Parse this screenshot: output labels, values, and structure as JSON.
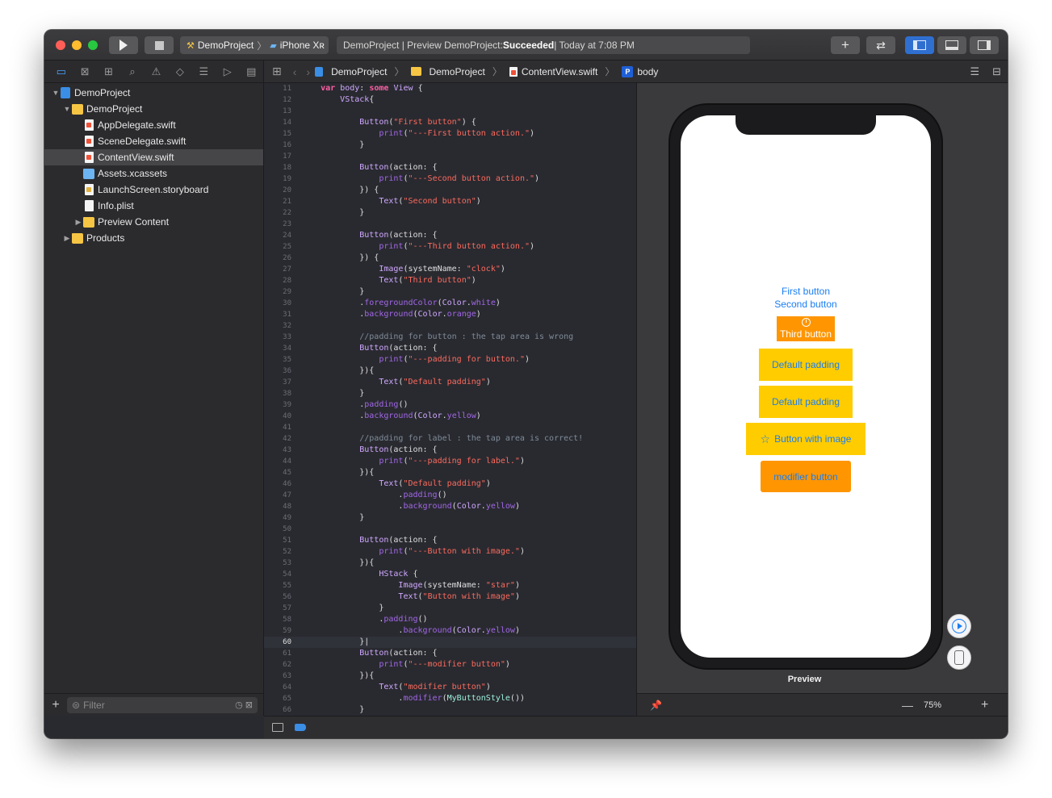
{
  "toolbar": {
    "scheme_project": "DemoProject",
    "scheme_device": "iPhone Xʀ",
    "status_prefix": "DemoProject | Preview DemoProject: ",
    "status_result": "Succeeded",
    "status_suffix": " | Today at 7:08 PM"
  },
  "navigator": {
    "items": [
      {
        "label": "DemoProject",
        "kind": "project",
        "indent": 0,
        "disclosure": "▼"
      },
      {
        "label": "DemoProject",
        "kind": "folder",
        "indent": 1,
        "disclosure": "▼"
      },
      {
        "label": "AppDelegate.swift",
        "kind": "swift",
        "indent": 2,
        "disclosure": ""
      },
      {
        "label": "SceneDelegate.swift",
        "kind": "swift",
        "indent": 2,
        "disclosure": ""
      },
      {
        "label": "ContentView.swift",
        "kind": "swift",
        "indent": 2,
        "disclosure": "",
        "selected": true
      },
      {
        "label": "Assets.xcassets",
        "kind": "assets",
        "indent": 2,
        "disclosure": ""
      },
      {
        "label": "LaunchScreen.storyboard",
        "kind": "storyboard",
        "indent": 2,
        "disclosure": ""
      },
      {
        "label": "Info.plist",
        "kind": "file",
        "indent": 2,
        "disclosure": ""
      },
      {
        "label": "Preview Content",
        "kind": "folder",
        "indent": 2,
        "disclosure": "▶"
      },
      {
        "label": "Products",
        "kind": "folder",
        "indent": 1,
        "disclosure": "▶"
      }
    ],
    "filter_placeholder": "Filter"
  },
  "jumpbar": {
    "crumbs": [
      "DemoProject",
      "DemoProject",
      "ContentView.swift",
      "body"
    ]
  },
  "editor": {
    "current_line": 60,
    "lines": [
      {
        "n": "11",
        "html": "    <span class='k'>var</span> <span class='t'>body</span>: <span class='k'>some</span> <span class='t'>View</span> {"
      },
      {
        "n": "12",
        "html": "        <span class='t'>VStack</span>{"
      },
      {
        "n": "13",
        "html": ""
      },
      {
        "n": "14",
        "html": "            <span class='t'>Button</span>(<span class='s'>\"First button\"</span>) {"
      },
      {
        "n": "15",
        "html": "                <span class='m'>print</span>(<span class='s'>\"---First button action.\"</span>)"
      },
      {
        "n": "16",
        "html": "            }"
      },
      {
        "n": "17",
        "html": ""
      },
      {
        "n": "18",
        "html": "            <span class='t'>Button</span>(action: {"
      },
      {
        "n": "19",
        "html": "                <span class='m'>print</span>(<span class='s'>\"---Second button action.\"</span>)"
      },
      {
        "n": "20",
        "html": "            }) {"
      },
      {
        "n": "21",
        "html": "                <span class='t'>Text</span>(<span class='s'>\"Second button\"</span>)"
      },
      {
        "n": "22",
        "html": "            }"
      },
      {
        "n": "23",
        "html": ""
      },
      {
        "n": "24",
        "html": "            <span class='t'>Button</span>(action: {"
      },
      {
        "n": "25",
        "html": "                <span class='m'>print</span>(<span class='s'>\"---Third button action.\"</span>)"
      },
      {
        "n": "26",
        "html": "            }) {"
      },
      {
        "n": "27",
        "html": "                <span class='t'>Image</span>(systemName: <span class='s'>\"clock\"</span>)"
      },
      {
        "n": "28",
        "html": "                <span class='t'>Text</span>(<span class='s'>\"Third button\"</span>)"
      },
      {
        "n": "29",
        "html": "            }"
      },
      {
        "n": "30",
        "html": "            .<span class='m'>foregroundColor</span>(<span class='t'>Color</span>.<span class='m'>white</span>)"
      },
      {
        "n": "31",
        "html": "            .<span class='m'>background</span>(<span class='t'>Color</span>.<span class='m'>orange</span>)"
      },
      {
        "n": "32",
        "html": ""
      },
      {
        "n": "33",
        "html": "            <span class='c'>//padding for button : the tap area is wrong</span>"
      },
      {
        "n": "34",
        "html": "            <span class='t'>Button</span>(action: {"
      },
      {
        "n": "35",
        "html": "                <span class='m'>print</span>(<span class='s'>\"---padding for button.\"</span>)"
      },
      {
        "n": "36",
        "html": "            }){"
      },
      {
        "n": "37",
        "html": "                <span class='t'>Text</span>(<span class='s'>\"Default padding\"</span>)"
      },
      {
        "n": "38",
        "html": "            }"
      },
      {
        "n": "39",
        "html": "            .<span class='m'>padding</span>()"
      },
      {
        "n": "40",
        "html": "            .<span class='m'>background</span>(<span class='t'>Color</span>.<span class='m'>yellow</span>)"
      },
      {
        "n": "41",
        "html": ""
      },
      {
        "n": "42",
        "html": "            <span class='c'>//padding for label : the tap area is correct!</span>"
      },
      {
        "n": "43",
        "html": "            <span class='t'>Button</span>(action: {"
      },
      {
        "n": "44",
        "html": "                <span class='m'>print</span>(<span class='s'>\"---padding for label.\"</span>)"
      },
      {
        "n": "45",
        "html": "            }){"
      },
      {
        "n": "46",
        "html": "                <span class='t'>Text</span>(<span class='s'>\"Default padding\"</span>)"
      },
      {
        "n": "47",
        "html": "                    .<span class='m'>padding</span>()"
      },
      {
        "n": "48",
        "html": "                    .<span class='m'>background</span>(<span class='t'>Color</span>.<span class='m'>yellow</span>)"
      },
      {
        "n": "49",
        "html": "            }"
      },
      {
        "n": "50",
        "html": ""
      },
      {
        "n": "51",
        "html": "            <span class='t'>Button</span>(action: {"
      },
      {
        "n": "52",
        "html": "                <span class='m'>print</span>(<span class='s'>\"---Button with image.\"</span>)"
      },
      {
        "n": "53",
        "html": "            }){"
      },
      {
        "n": "54",
        "html": "                <span class='t'>HStack</span> {"
      },
      {
        "n": "55",
        "html": "                    <span class='t'>Image</span>(systemName: <span class='s'>\"star\"</span>)"
      },
      {
        "n": "56",
        "html": "                    <span class='t'>Text</span>(<span class='s'>\"Button with image\"</span>)"
      },
      {
        "n": "57",
        "html": "                }"
      },
      {
        "n": "58",
        "html": "                .<span class='m'>padding</span>()"
      },
      {
        "n": "59",
        "html": "                    .<span class='m'>background</span>(<span class='t'>Color</span>.<span class='m'>yellow</span>)"
      },
      {
        "n": "60",
        "html": "            }|"
      },
      {
        "n": "61",
        "html": "            <span class='t'>Button</span>(action: {"
      },
      {
        "n": "62",
        "html": "                <span class='m'>print</span>(<span class='s'>\"---modifier button\"</span>)"
      },
      {
        "n": "63",
        "html": "            }){"
      },
      {
        "n": "64",
        "html": "                <span class='t'>Text</span>(<span class='s'>\"modifier button\"</span>)"
      },
      {
        "n": "65",
        "html": "                    .<span class='m'>modifier</span>(<span class='ty'>MyButtonStyle</span>())"
      },
      {
        "n": "66",
        "html": "            }"
      }
    ]
  },
  "preview": {
    "first_button": "First button",
    "second_button": "Second button",
    "third_button": "Third button",
    "default_padding_1": "Default padding",
    "default_padding_2": "Default padding",
    "button_with_image": "Button with image",
    "modifier_button": "modifier button",
    "label": "Preview",
    "zoom": "75%"
  },
  "colors": {
    "ios_blue": "#1a7ef2",
    "yellow": "#ffcc00",
    "orange": "#ff9500"
  }
}
